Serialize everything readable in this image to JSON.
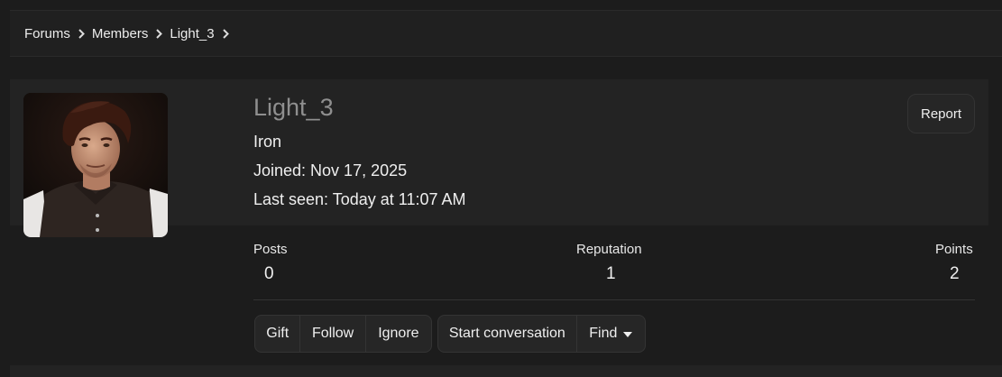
{
  "breadcrumb": {
    "items": [
      "Forums",
      "Members",
      "Light_3"
    ]
  },
  "profile": {
    "username": "Light_3",
    "user_title": "Iron",
    "joined": "Joined: Nov 17, 2025",
    "last_seen": "Last seen: Today at 11:07 AM",
    "report_label": "Report"
  },
  "stats": {
    "posts_label": "Posts",
    "posts_value": "0",
    "reputation_label": "Reputation",
    "reputation_value": "1",
    "points_label": "Points",
    "points_value": "2"
  },
  "actions": {
    "gift": "Gift",
    "follow": "Follow",
    "ignore": "Ignore",
    "start_conversation": "Start conversation",
    "find": "Find"
  },
  "icons": {
    "breadcrumb_separator": "chevron-right-icon",
    "find_caret": "caret-down-icon"
  }
}
